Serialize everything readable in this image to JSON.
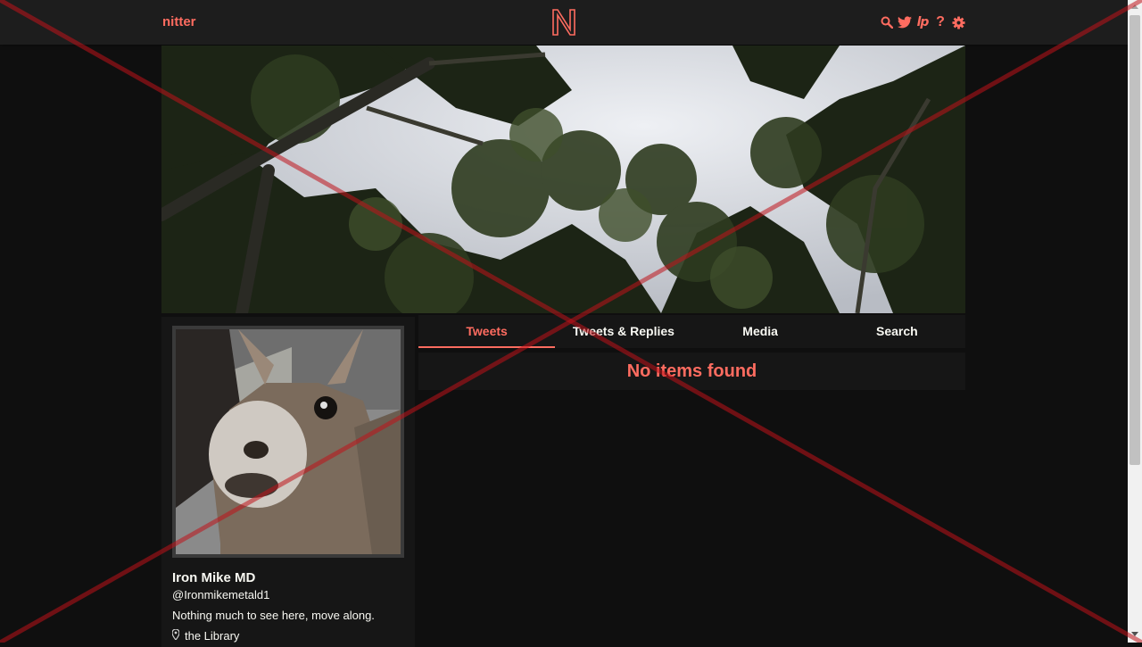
{
  "navbar": {
    "brand": "nitter",
    "logo_letter": "N",
    "icons": [
      "search-icon",
      "twitter-icon",
      "liberapay-icon",
      "help-icon",
      "gear-icon"
    ],
    "liberapay_text": "lp",
    "help_text": "?"
  },
  "profile": {
    "fullname": "Iron Mike MD",
    "username": "@Ironmikemetald1",
    "bio": "Nothing much to see here, move along.",
    "location": "the Library"
  },
  "tabs": [
    {
      "label": "Tweets",
      "active": true
    },
    {
      "label": "Tweets & Replies",
      "active": false
    },
    {
      "label": "Media",
      "active": false
    },
    {
      "label": "Search",
      "active": false
    }
  ],
  "timeline": {
    "message": "No items found"
  },
  "colors": {
    "accent": "#ff6c60",
    "background": "#0f0f0f",
    "panel": "#161616",
    "navbar": "#1d1d1d",
    "cross_overlay": "#c0121a"
  }
}
